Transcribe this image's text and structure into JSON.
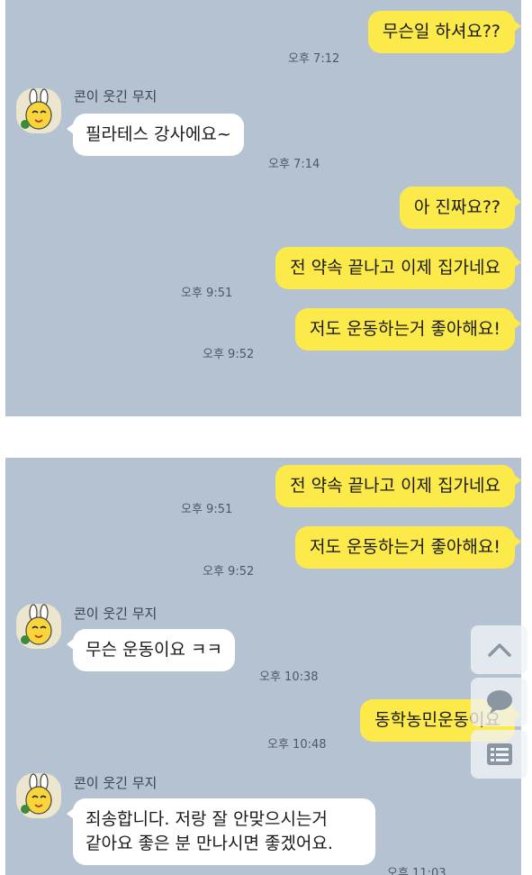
{
  "panel1": {
    "m1": {
      "text": "무슨일 하셔요??",
      "time": "오후 7:12"
    },
    "sender": "콘이 웃긴 무지",
    "m2": {
      "text": "필라테스 강사에요~",
      "time": "오후 7:14"
    },
    "m3": {
      "text": "아 진짜요??"
    },
    "m4": {
      "text": "전 약속 끝나고 이제 집가네요",
      "time": "오후 9:51"
    },
    "m5": {
      "text": "저도 운동하는거 좋아해요!",
      "time": "오후 9:52"
    }
  },
  "panel2": {
    "m1": {
      "text": "전 약속 끝나고 이제 집가네요",
      "time": "오후 9:51"
    },
    "m2": {
      "text": "저도 운동하는거 좋아해요!",
      "time": "오후 9:52"
    },
    "sender1": "콘이 웃긴 무지",
    "m3": {
      "text": "무슨 운동이요 ㅋㅋ",
      "time": "오후 10:38"
    },
    "m4": {
      "text": "동학농민운동이요",
      "time": "오후 10:48"
    },
    "sender2": "콘이 웃긴 무지",
    "m5": {
      "line1": "죄송합니다. 저랑 잘 안맞으시는거",
      "line2": "같아요 좋은 분 만나시면 좋겠어요.",
      "time": "오후 11:03"
    }
  },
  "side_buttons": {
    "icons": [
      "chevron-up-icon",
      "emoticon-icon",
      "menu-icon"
    ]
  },
  "colors": {
    "background": "#b4c2d2",
    "my_bubble": "#fce94a",
    "their_bubble": "#ffffff"
  }
}
